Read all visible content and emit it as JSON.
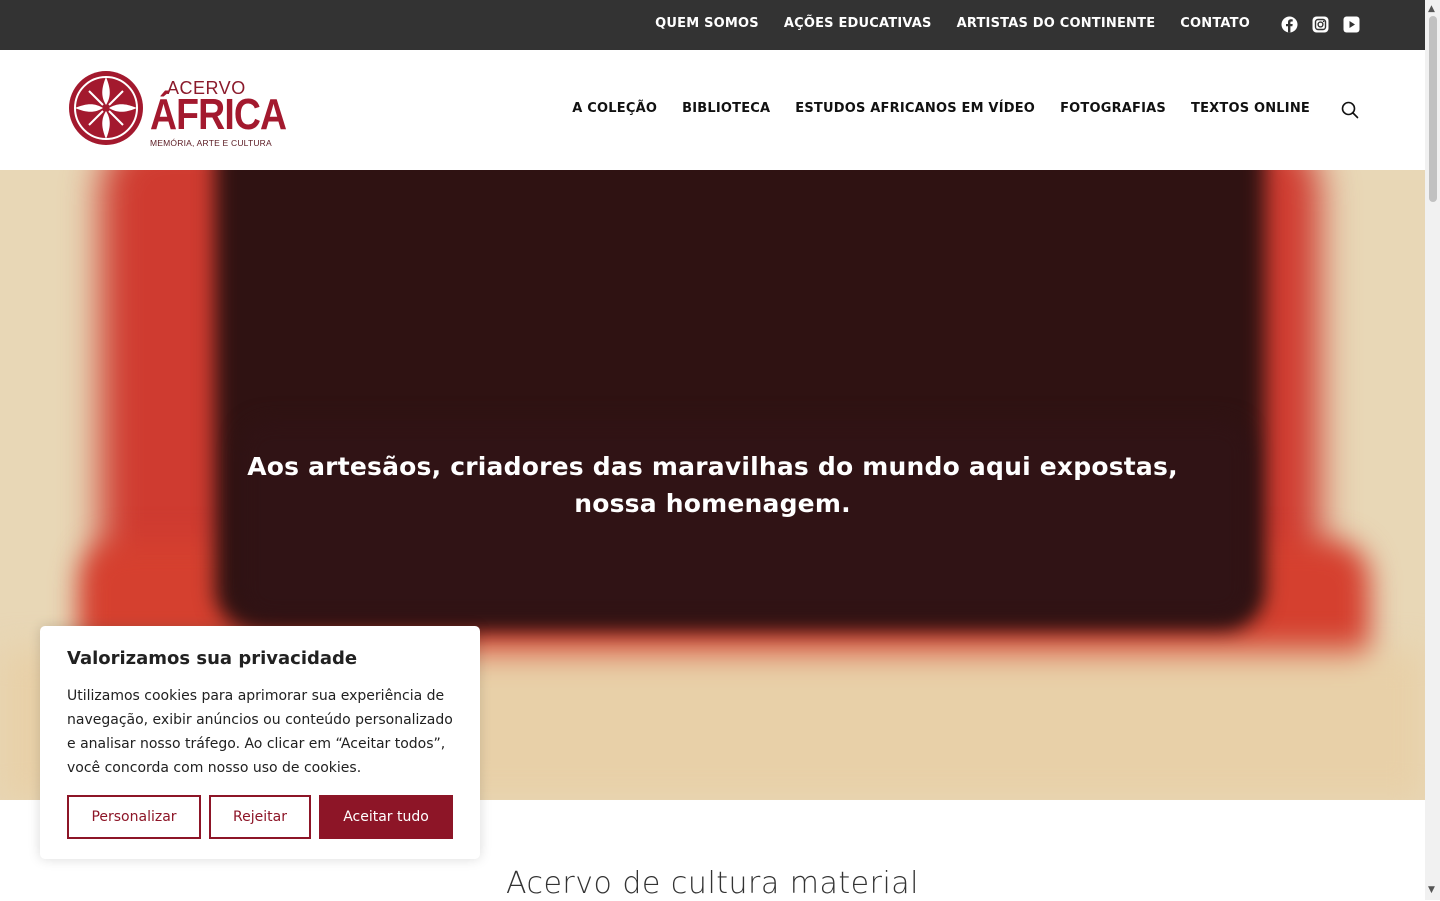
{
  "topbar": {
    "links": [
      "QUEM SOMOS",
      "AÇÕES EDUCATIVAS",
      "ARTISTAS DO CONTINENTE",
      "CONTATO"
    ],
    "social_icons": [
      "facebook-icon",
      "instagram-icon",
      "youtube-icon"
    ]
  },
  "logo": {
    "line1": "ACERVO",
    "line2": "ÁFRICA",
    "line3": "MEMÓRIA, ARTE E CULTURA"
  },
  "mainnav": {
    "links": [
      "A COLEÇÃO",
      "BIBLIOTECA",
      "ESTUDOS AFRICANOS EM VÍDEO",
      "FOTOGRAFIAS",
      "TEXTOS ONLINE"
    ],
    "search_icon": "search-icon"
  },
  "hero": {
    "line1": "Aos artesãos, criadores das maravilhas do mundo aqui expostas,",
    "line2": "nossa homenagem."
  },
  "section": {
    "title": "Acervo de cultura material"
  },
  "cookie": {
    "title": "Valorizamos sua privacidade",
    "text": "Utilizamos cookies para aprimorar sua experiência de navegação, exibir anúncios ou conteúdo personalizado e analisar nosso tráfego. Ao clicar em “Aceitar todos”, você concorda com nosso uso de cookies.",
    "customize": "Personalizar",
    "reject": "Rejeitar",
    "accept": "Aceitar tudo"
  },
  "colors": {
    "brand": "#8d1527",
    "topbar": "#333333"
  }
}
